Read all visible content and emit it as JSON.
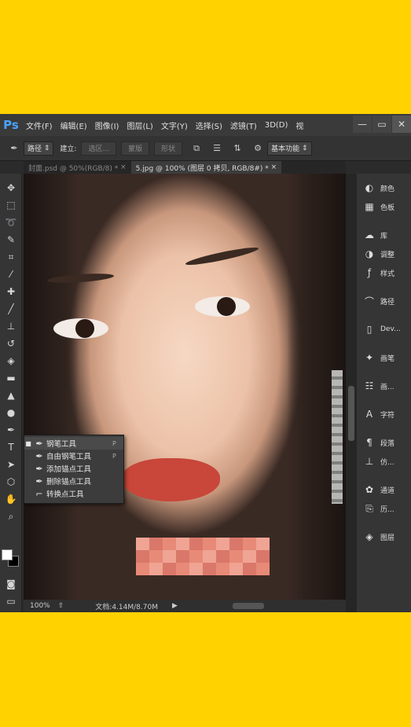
{
  "app": {
    "logo": "Ps"
  },
  "menu": [
    "文件(F)",
    "编辑(E)",
    "图像(I)",
    "图层(L)",
    "文字(Y)",
    "选择(S)",
    "滤镜(T)",
    "3D(D)",
    "视"
  ],
  "window_controls": [
    "minimize-icon",
    "maximize-icon",
    "close-icon"
  ],
  "options_bar": {
    "mode_select": "路径",
    "make_label": "建立:",
    "selection_button": "选区...",
    "mask_button": "蒙版",
    "shape_button": "形状",
    "workspace_select": "基本功能"
  },
  "tabs": [
    {
      "label": "封面.psd @ 50%(RGB/8) *",
      "close": "×"
    },
    {
      "label": "5.jpg @ 100% (图层 0 拷贝, RGB/8#) *",
      "close": "×"
    }
  ],
  "tools": [
    "move-icon",
    "marquee-icon",
    "lasso-icon",
    "quick-select-icon",
    "crop-icon",
    "eyedropper-icon",
    "healing-icon",
    "brush-icon",
    "stamp-icon",
    "history-brush-icon",
    "eraser-icon",
    "gradient-icon",
    "blur-icon",
    "dodge-icon",
    "pen-icon",
    "type-icon",
    "path-select-icon",
    "shape-icon",
    "hand-icon",
    "zoom-icon"
  ],
  "flyout": [
    {
      "label": "钢笔工具",
      "key": "P",
      "selected": true
    },
    {
      "label": "自由钢笔工具",
      "key": "P",
      "selected": false
    },
    {
      "label": "添加锚点工具",
      "key": "",
      "selected": false
    },
    {
      "label": "删除锚点工具",
      "key": "",
      "selected": false
    },
    {
      "label": "转换点工具",
      "key": "",
      "selected": false
    }
  ],
  "status": {
    "zoom": "100%",
    "doc": "文档:4.14M/8.70M"
  },
  "panels": [
    {
      "icon": "color-icon",
      "label": "颜色"
    },
    {
      "icon": "swatches-icon",
      "label": "色板"
    },
    {
      "icon": "library-icon",
      "label": "库"
    },
    {
      "icon": "adjust-icon",
      "label": "调整"
    },
    {
      "icon": "styles-icon",
      "label": "样式"
    },
    {
      "icon": "paths-icon",
      "label": "路径"
    },
    {
      "icon": "device-icon",
      "label": "Dev..."
    },
    {
      "icon": "brush-preset-icon",
      "label": "画笔"
    },
    {
      "icon": "brush-settings-icon",
      "label": "画..."
    },
    {
      "icon": "character-icon",
      "label": "字符"
    },
    {
      "icon": "paragraph-icon",
      "label": "段落"
    },
    {
      "icon": "clone-source-icon",
      "label": "仿..."
    },
    {
      "icon": "channels-icon",
      "label": "通道"
    },
    {
      "icon": "history-icon",
      "label": "历..."
    },
    {
      "icon": "layers-icon",
      "label": "图层"
    }
  ],
  "colors": {
    "page_bg": "#FFD200",
    "ps_bg": "#2b2b2b",
    "ps_accent": "#4aa3ff"
  }
}
